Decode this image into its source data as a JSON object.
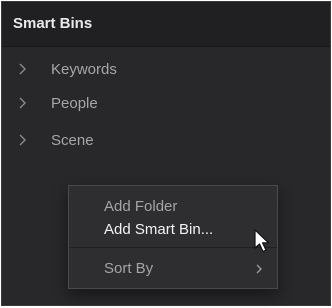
{
  "panel": {
    "title": "Smart Bins",
    "items": [
      {
        "label": "Keywords",
        "icon": "chevron-right-icon"
      },
      {
        "label": "People",
        "icon": "chevron-right-icon"
      },
      {
        "label": "Scene",
        "icon": "chevron-right-icon"
      }
    ]
  },
  "context_menu": {
    "items": [
      {
        "label": "Add Folder",
        "highlighted": false
      },
      {
        "label": "Add Smart Bin...",
        "highlighted": true
      },
      {
        "label": "Sort By",
        "has_submenu": true,
        "submenu_icon": "chevron-right-icon"
      }
    ]
  },
  "pointer": {
    "icon": "mouse-pointer-icon"
  },
  "colors": {
    "panel_bg": "#28282a",
    "header_bg": "#202022",
    "text_primary": "#e9e9eb",
    "text_secondary": "#a6a6a9",
    "menu_bg": "#2e2e31"
  }
}
